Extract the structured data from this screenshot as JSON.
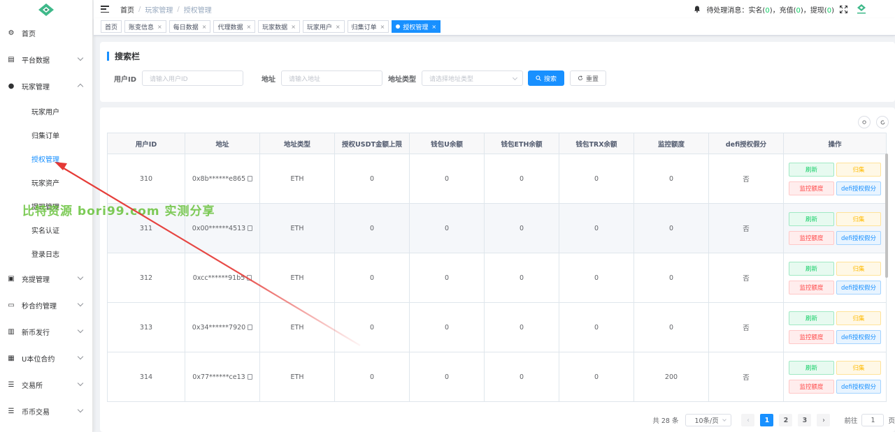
{
  "sidebar": {
    "items": [
      {
        "label": "首页",
        "icon": "dashboard-icon"
      },
      {
        "label": "平台数据",
        "icon": "chart-icon",
        "chevron": "down"
      },
      {
        "label": "玩家管理",
        "icon": "user-icon",
        "chevron": "up"
      },
      {
        "label": "充提管理",
        "icon": "wallet-icon",
        "chevron": "down"
      },
      {
        "label": "秒合约管理",
        "icon": "monitor-icon",
        "chevron": "down"
      },
      {
        "label": "新币发行",
        "icon": "coin-icon",
        "chevron": "down"
      },
      {
        "label": "U本位合约",
        "icon": "grid-icon",
        "chevron": "down"
      },
      {
        "label": "交易所",
        "icon": "list-icon",
        "chevron": "down"
      },
      {
        "label": "币币交易",
        "icon": "exchange-icon",
        "chevron": "down"
      }
    ],
    "sub_items": [
      "玩家用户",
      "归集订单",
      "授权管理",
      "玩家资产",
      "提现管理",
      "实名认证",
      "登录日志"
    ],
    "active_sub": "授权管理"
  },
  "header": {
    "breadcrumb": [
      "首页",
      "玩家管理",
      "授权管理"
    ],
    "notice_label": "待处理消息：",
    "notice_items": [
      {
        "label": "实名(",
        "count": "0",
        "suffix": ")，"
      },
      {
        "label": "充值(",
        "count": "0",
        "suffix": ")，"
      },
      {
        "label": "提现(",
        "count": "0",
        "suffix": ")"
      }
    ]
  },
  "tags": [
    {
      "label": "首页",
      "closable": false
    },
    {
      "label": "账变信息",
      "closable": true
    },
    {
      "label": "每日数据",
      "closable": true
    },
    {
      "label": "代理数据",
      "closable": true
    },
    {
      "label": "玩家数据",
      "closable": true
    },
    {
      "label": "玩家用户",
      "closable": true
    },
    {
      "label": "归集订单",
      "closable": true
    },
    {
      "label": "授权管理",
      "closable": true,
      "active": true
    }
  ],
  "search": {
    "title": "搜索栏",
    "user_id_label": "用户ID",
    "user_id_placeholder": "请输入用户ID",
    "address_label": "地址",
    "address_placeholder": "请输入地址",
    "type_label": "地址类型",
    "type_placeholder": "请选择地址类型",
    "search_button": "搜索",
    "reset_button": "重置"
  },
  "table": {
    "columns": [
      "用户ID",
      "地址",
      "地址类型",
      "授权USDT金额上限",
      "钱包U余额",
      "钱包ETH余额",
      "钱包TRX余额",
      "监控额度",
      "defi授权假分",
      "操作"
    ],
    "rows": [
      {
        "user_id": "310",
        "address": "0x8b******e865",
        "type": "ETH",
        "usdt_limit": "0",
        "u_balance": "0",
        "eth_balance": "0",
        "trx_balance": "0",
        "monitor": "0",
        "defi": "否"
      },
      {
        "user_id": "311",
        "address": "0x00******4513",
        "type": "ETH",
        "usdt_limit": "0",
        "u_balance": "0",
        "eth_balance": "0",
        "trx_balance": "0",
        "monitor": "0",
        "defi": "否"
      },
      {
        "user_id": "312",
        "address": "0xcc******91b5",
        "type": "ETH",
        "usdt_limit": "0",
        "u_balance": "0",
        "eth_balance": "0",
        "trx_balance": "0",
        "monitor": "0",
        "defi": "否"
      },
      {
        "user_id": "313",
        "address": "0x34******7920",
        "type": "ETH",
        "usdt_limit": "0",
        "u_balance": "0",
        "eth_balance": "0",
        "trx_balance": "0",
        "monitor": "0",
        "defi": "否"
      },
      {
        "user_id": "314",
        "address": "0x77******ce13",
        "type": "ETH",
        "usdt_limit": "0",
        "u_balance": "0",
        "eth_balance": "0",
        "trx_balance": "0",
        "monitor": "200",
        "defi": "否"
      }
    ],
    "actions": {
      "refresh": "刷新",
      "collect": "归集",
      "monitor": "监控额度",
      "defi": "defi授权假分"
    }
  },
  "pagination": {
    "total": "共 28 条",
    "page_size": "10条/页",
    "pages": [
      "1",
      "2",
      "3"
    ],
    "current": "1",
    "goto_label": "前往",
    "goto_value": "1",
    "goto_suffix": "页"
  },
  "watermark": "比特资源 bori99.com 实测分享",
  "colors": {
    "primary": "#1890ff",
    "success": "#13ce66",
    "warning": "#ffba00",
    "danger": "#ff4949",
    "arrow": "#e53935"
  }
}
